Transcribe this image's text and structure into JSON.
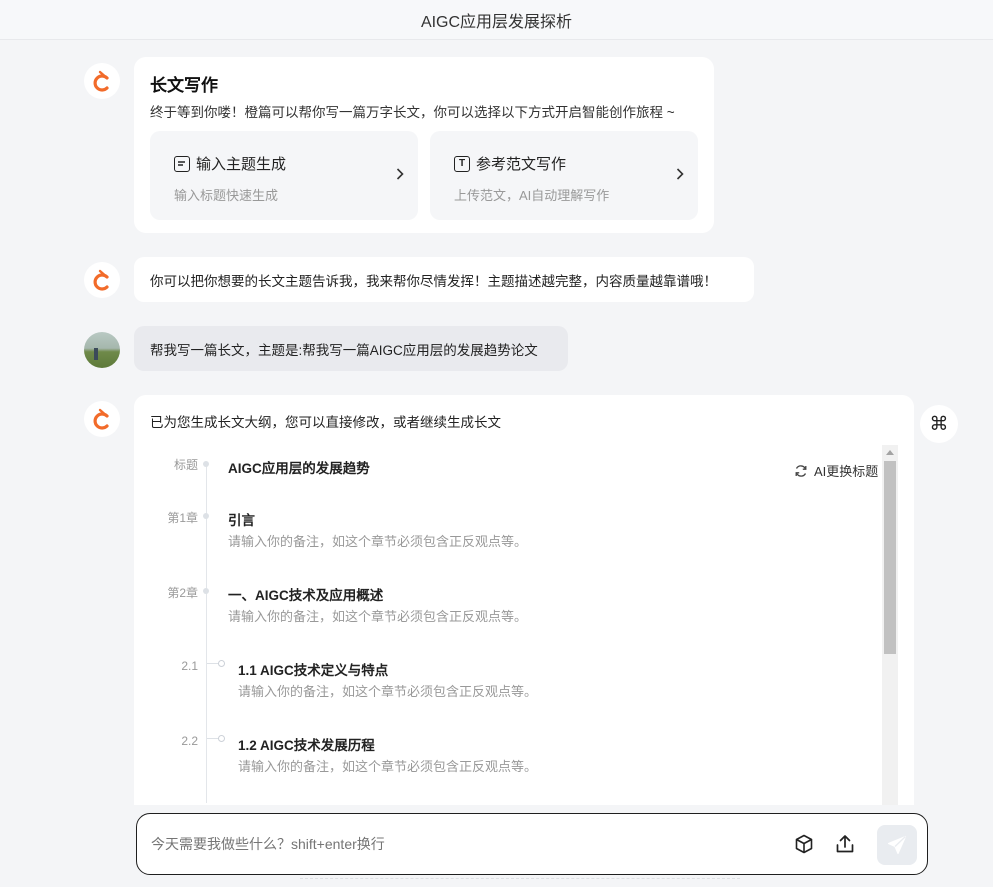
{
  "header": {
    "title": "AIGC应用层发展探析"
  },
  "intro_card": {
    "title": "长文写作",
    "subtitle": "终于等到你喽！橙篇可以帮你写一篇万字长文，你可以选择以下方式开启智能创作旅程 ~",
    "options": [
      {
        "title": "输入主题生成",
        "desc": "输入标题快速生成",
        "icon": "document-lines-icon"
      },
      {
        "title": "参考范文写作",
        "desc": "上传范文，AI自动理解写作",
        "icon": "text-t-icon"
      }
    ]
  },
  "messages": {
    "bot_prompt": "你可以把你想要的长文主题告诉我，我来帮你尽情发挥！主题描述越完整，内容质量越靠谱哦！",
    "user_request": "帮我写一篇长文，主题是:帮我写一篇AIGC应用层的发展趋势论文",
    "bot_reply": "已为您生成长文大纲，您可以直接修改，或者继续生成长文"
  },
  "outline": {
    "regen_title_label": "AI更换标题",
    "title_label": "标题",
    "title": "AIGC应用层的发展趋势",
    "note_placeholder": "请输入你的备注，如这个章节必须包含正反观点等。",
    "chapters": [
      {
        "label": "第1章",
        "title": "引言"
      },
      {
        "label": "第2章",
        "title": "一、AIGC技术及应用概述"
      }
    ],
    "sections": [
      {
        "label": "2.1",
        "title": "1.1 AIGC技术定义与特点"
      },
      {
        "label": "2.2",
        "title": "1.2 AIGC技术发展历程"
      }
    ]
  },
  "composer": {
    "placeholder": "今天需要我做些什么？shift+enter换行"
  },
  "colors": {
    "brand_orange": "#f26b2a",
    "send_disabled": "#e9ecf0"
  }
}
